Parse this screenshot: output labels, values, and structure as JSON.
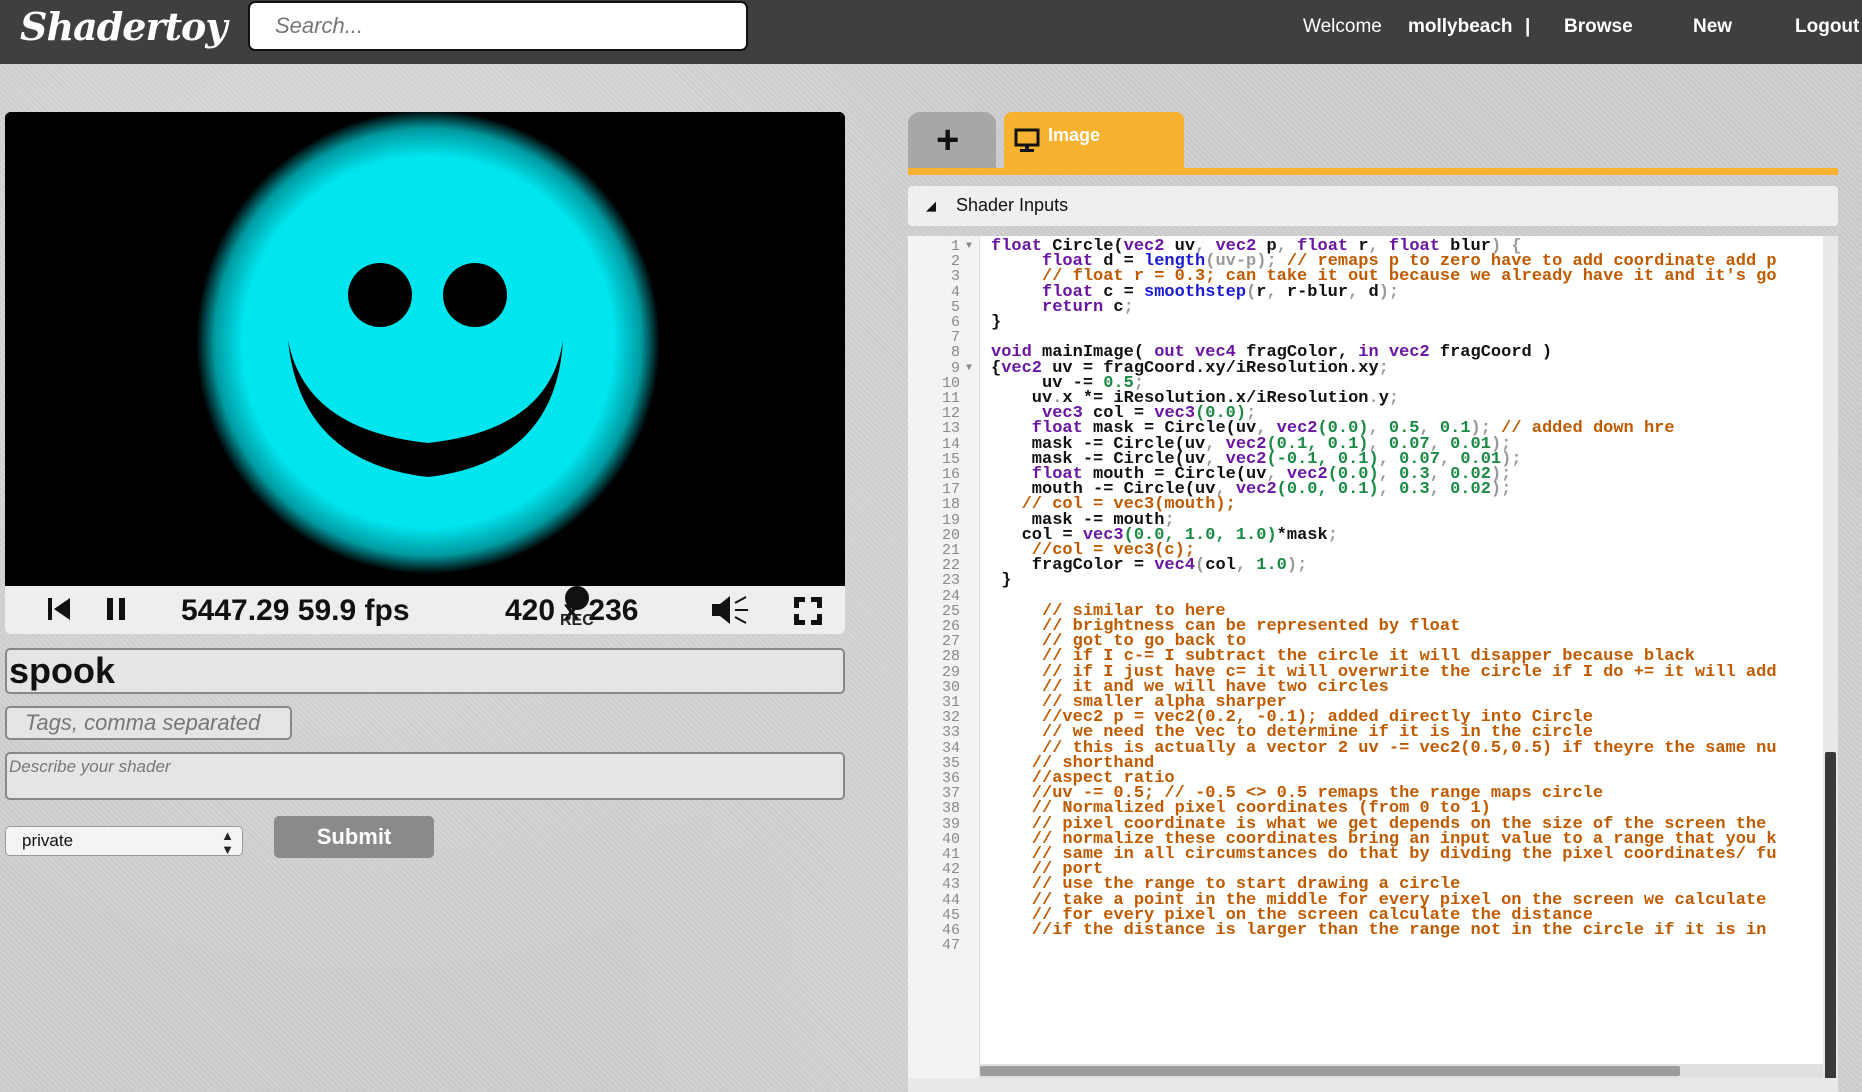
{
  "header": {
    "logo": "Shadertoy",
    "search_placeholder": "Search...",
    "welcome": "Welcome",
    "username": "mollybeach",
    "separator": "|",
    "browse": "Browse",
    "new": "New",
    "logout": "Logout"
  },
  "player": {
    "time_fps": "5447.29 59.9 fps",
    "resolution": "420 x 236",
    "rec_label": "REC",
    "face_color": "#00e5ee"
  },
  "form": {
    "title": "spook",
    "tags_placeholder": "Tags, comma separated",
    "description_placeholder": "Describe your shader",
    "visibility": "private",
    "submit": "Submit"
  },
  "editor": {
    "add_tab": "+",
    "image_tab": "Image",
    "shader_inputs": "Shader Inputs",
    "lines": [
      [
        {
          "t": "float ",
          "c": "kw"
        },
        {
          "t": "Circle(",
          "c": ""
        },
        {
          "t": "vec2 ",
          "c": "kw"
        },
        {
          "t": "uv",
          "c": ""
        },
        {
          "t": ", ",
          "c": "pn"
        },
        {
          "t": "vec2 ",
          "c": "kw"
        },
        {
          "t": "p",
          "c": ""
        },
        {
          "t": ", ",
          "c": "pn"
        },
        {
          "t": "float ",
          "c": "kw"
        },
        {
          "t": "r",
          "c": ""
        },
        {
          "t": ", ",
          "c": "pn"
        },
        {
          "t": "float ",
          "c": "kw"
        },
        {
          "t": "blur",
          "c": ""
        },
        {
          "t": ") {",
          "c": "pn"
        }
      ],
      [
        {
          "t": "     float ",
          "c": "kw"
        },
        {
          "t": "d = ",
          "c": ""
        },
        {
          "t": "length",
          "c": "fn"
        },
        {
          "t": "(uv-p); ",
          "c": "pn"
        },
        {
          "t": "// remaps p to zero have to add coordinate add p",
          "c": "cm"
        }
      ],
      [
        {
          "t": "     // float r = 0.3; can take it out because we already have it and it's go",
          "c": "cm"
        }
      ],
      [
        {
          "t": "     float ",
          "c": "kw"
        },
        {
          "t": "c = ",
          "c": ""
        },
        {
          "t": "smoothstep",
          "c": "fn"
        },
        {
          "t": "(",
          "c": "pn"
        },
        {
          "t": "r",
          "c": ""
        },
        {
          "t": ", ",
          "c": "pn"
        },
        {
          "t": "r-blur",
          "c": ""
        },
        {
          "t": ", ",
          "c": "pn"
        },
        {
          "t": "d",
          "c": ""
        },
        {
          "t": ");",
          "c": "pn"
        }
      ],
      [
        {
          "t": "     return ",
          "c": "kw"
        },
        {
          "t": "c",
          "c": ""
        },
        {
          "t": ";",
          "c": "pn"
        }
      ],
      [
        {
          "t": "}",
          "c": ""
        }
      ],
      [
        {
          "t": "",
          "c": ""
        }
      ],
      [
        {
          "t": "void ",
          "c": "kw"
        },
        {
          "t": "mainImage( ",
          "c": ""
        },
        {
          "t": "out vec4 ",
          "c": "kw"
        },
        {
          "t": "fragColor, ",
          "c": ""
        },
        {
          "t": "in vec2 ",
          "c": "kw"
        },
        {
          "t": "fragCoord )",
          "c": ""
        }
      ],
      [
        {
          "t": "{",
          "c": ""
        },
        {
          "t": "vec2 ",
          "c": "kw"
        },
        {
          "t": "uv = fragCoord.xy/iResolution.xy",
          "c": ""
        },
        {
          "t": ";",
          "c": "pn"
        }
      ],
      [
        {
          "t": "     uv -= ",
          "c": ""
        },
        {
          "t": "0.5",
          "c": "nm"
        },
        {
          "t": ";",
          "c": "pn"
        }
      ],
      [
        {
          "t": "    uv",
          "c": ""
        },
        {
          "t": ".",
          "c": "pn"
        },
        {
          "t": "x *= iResolution.x/iResolution",
          "c": ""
        },
        {
          "t": ".",
          "c": "pn"
        },
        {
          "t": "y",
          "c": ""
        },
        {
          "t": ";",
          "c": "pn"
        }
      ],
      [
        {
          "t": "     vec3 ",
          "c": "kw"
        },
        {
          "t": "col = ",
          "c": ""
        },
        {
          "t": "vec3",
          "c": "kw"
        },
        {
          "t": "(0.0)",
          "c": "nm"
        },
        {
          "t": ";",
          "c": "pn"
        }
      ],
      [
        {
          "t": "    float ",
          "c": "kw"
        },
        {
          "t": "mask = Circle(uv",
          "c": ""
        },
        {
          "t": ", ",
          "c": "pn"
        },
        {
          "t": "vec2",
          "c": "kw"
        },
        {
          "t": "(0.0)",
          "c": "nm"
        },
        {
          "t": ", ",
          "c": "pn"
        },
        {
          "t": "0.5",
          "c": "nm"
        },
        {
          "t": ", ",
          "c": "pn"
        },
        {
          "t": "0.1",
          "c": "nm"
        },
        {
          "t": "); ",
          "c": "pn"
        },
        {
          "t": "// added down hre",
          "c": "cm"
        }
      ],
      [
        {
          "t": "    mask -= Circle(uv",
          "c": ""
        },
        {
          "t": ", ",
          "c": "pn"
        },
        {
          "t": "vec2",
          "c": "kw"
        },
        {
          "t": "(0.1, 0.1)",
          "c": "nm"
        },
        {
          "t": ", ",
          "c": "pn"
        },
        {
          "t": "0.07",
          "c": "nm"
        },
        {
          "t": ", ",
          "c": "pn"
        },
        {
          "t": "0.01",
          "c": "nm"
        },
        {
          "t": ");",
          "c": "pn"
        }
      ],
      [
        {
          "t": "    mask -= Circle(uv",
          "c": ""
        },
        {
          "t": ", ",
          "c": "pn"
        },
        {
          "t": "vec2",
          "c": "kw"
        },
        {
          "t": "(-0.1, 0.1)",
          "c": "nm"
        },
        {
          "t": ", ",
          "c": "pn"
        },
        {
          "t": "0.07",
          "c": "nm"
        },
        {
          "t": ", ",
          "c": "pn"
        },
        {
          "t": "0.01",
          "c": "nm"
        },
        {
          "t": ");",
          "c": "pn"
        }
      ],
      [
        {
          "t": "    float ",
          "c": "kw"
        },
        {
          "t": "mouth = Circle(uv",
          "c": ""
        },
        {
          "t": ", ",
          "c": "pn"
        },
        {
          "t": "vec2",
          "c": "kw"
        },
        {
          "t": "(0.0)",
          "c": "nm"
        },
        {
          "t": ", ",
          "c": "pn"
        },
        {
          "t": "0.3",
          "c": "nm"
        },
        {
          "t": ", ",
          "c": "pn"
        },
        {
          "t": "0.02",
          "c": "nm"
        },
        {
          "t": ");",
          "c": "pn"
        }
      ],
      [
        {
          "t": "    mouth -= Circle(uv",
          "c": ""
        },
        {
          "t": ", ",
          "c": "pn"
        },
        {
          "t": "vec2",
          "c": "kw"
        },
        {
          "t": "(0.0, 0.1)",
          "c": "nm"
        },
        {
          "t": ", ",
          "c": "pn"
        },
        {
          "t": "0.3",
          "c": "nm"
        },
        {
          "t": ", ",
          "c": "pn"
        },
        {
          "t": "0.02",
          "c": "nm"
        },
        {
          "t": ");",
          "c": "pn"
        }
      ],
      [
        {
          "t": "   // col = vec3(mouth);",
          "c": "cm"
        }
      ],
      [
        {
          "t": "    mask -= mouth",
          "c": ""
        },
        {
          "t": ";",
          "c": "pn"
        }
      ],
      [
        {
          "t": "   col = ",
          "c": ""
        },
        {
          "t": "vec3",
          "c": "kw"
        },
        {
          "t": "(0.0, 1.0, 1.0)",
          "c": "nm"
        },
        {
          "t": "*mask",
          "c": ""
        },
        {
          "t": ";",
          "c": "pn"
        }
      ],
      [
        {
          "t": "    //col = vec3(c);",
          "c": "cm"
        }
      ],
      [
        {
          "t": "    fragColor = ",
          "c": ""
        },
        {
          "t": "vec4",
          "c": "kw"
        },
        {
          "t": "(",
          "c": "pn"
        },
        {
          "t": "col",
          "c": ""
        },
        {
          "t": ", ",
          "c": "pn"
        },
        {
          "t": "1.0",
          "c": "nm"
        },
        {
          "t": ");",
          "c": "pn"
        }
      ],
      [
        {
          "t": " }",
          "c": ""
        }
      ],
      [
        {
          "t": "",
          "c": ""
        }
      ],
      [
        {
          "t": "     // similar to here",
          "c": "cm"
        }
      ],
      [
        {
          "t": "     // brightness can be represented by float",
          "c": "cm"
        }
      ],
      [
        {
          "t": "     // got to go back to",
          "c": "cm"
        }
      ],
      [
        {
          "t": "     // if I c-= I subtract the circle it will disapper because black",
          "c": "cm"
        }
      ],
      [
        {
          "t": "     // if I just have c= it will overwrite the circle if I do += it will add",
          "c": "cm"
        }
      ],
      [
        {
          "t": "     // it and we will have two circles",
          "c": "cm"
        }
      ],
      [
        {
          "t": "     // smaller alpha sharper",
          "c": "cm"
        }
      ],
      [
        {
          "t": "     //vec2 p = vec2(0.2, -0.1); added directly into Circle",
          "c": "cm"
        }
      ],
      [
        {
          "t": "     // we need the vec to determine if it is in the circle",
          "c": "cm"
        }
      ],
      [
        {
          "t": "     // this is actually a vector 2 uv -= vec2(0.5,0.5) if theyre the same nu",
          "c": "cm"
        }
      ],
      [
        {
          "t": "    // shorthand",
          "c": "cm"
        }
      ],
      [
        {
          "t": "    //aspect ratio",
          "c": "cm"
        }
      ],
      [
        {
          "t": "    //uv -= 0.5; // -0.5 <> 0.5 remaps the range maps circle",
          "c": "cm"
        }
      ],
      [
        {
          "t": "    // Normalized pixel coordinates (from 0 to 1)",
          "c": "cm"
        }
      ],
      [
        {
          "t": "    // pixel coordinate is what we get depends on the size of the screen the",
          "c": "cm"
        }
      ],
      [
        {
          "t": "    // normalize these coordinates bring an input value to a range that you k",
          "c": "cm"
        }
      ],
      [
        {
          "t": "    // same in all circumstances do that by divding the pixel coordinates/ fu",
          "c": "cm"
        }
      ],
      [
        {
          "t": "    // port",
          "c": "cm"
        }
      ],
      [
        {
          "t": "    // use the range to start drawing a circle",
          "c": "cm"
        }
      ],
      [
        {
          "t": "    // take a point in the middle for every pixel on the screen we calculate",
          "c": "cm"
        }
      ],
      [
        {
          "t": "    // for every pixel on the screen calculate the distance",
          "c": "cm"
        }
      ],
      [
        {
          "t": "    //if the distance is larger than the range not in the circle if it is in",
          "c": "cm"
        }
      ],
      [
        {
          "t": "",
          "c": ""
        }
      ]
    ],
    "folded_lines": [
      1,
      9
    ]
  }
}
